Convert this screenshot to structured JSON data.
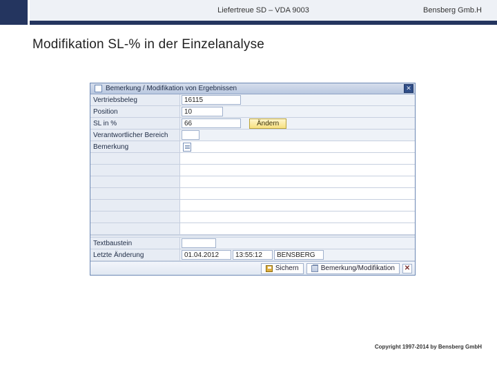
{
  "header": {
    "title": "Liefertreue SD – VDA 9003",
    "company": "Bensberg Gmb.H"
  },
  "page": {
    "title": "Modifikation SL-% in der Einzelanalyse"
  },
  "dialog": {
    "title": "Bemerkung / Modifikation von Ergebnissen",
    "fields": {
      "vertriebsbeleg": {
        "label": "Vertriebsbeleg",
        "value": "16115"
      },
      "position": {
        "label": "Position",
        "value": "10"
      },
      "sl": {
        "label": "SL in %",
        "value": "66",
        "button": "Ändern"
      },
      "bereich": {
        "label": "Verantwortlicher Bereich",
        "value": ""
      },
      "bemerkung": {
        "label": "Bemerkung"
      },
      "textbaustein": {
        "label": "Textbaustein",
        "value": ""
      },
      "letzte": {
        "label": "Letzte Änderung",
        "date": "01.04.2012",
        "time": "13:55:12",
        "user": "BENSBERG"
      }
    },
    "toolbar": {
      "save": "Sichern",
      "modify": "Bemerkung/Modifikation"
    }
  },
  "footer": {
    "copyright": "Copyright 1997-2014 by Bensberg GmbH"
  }
}
